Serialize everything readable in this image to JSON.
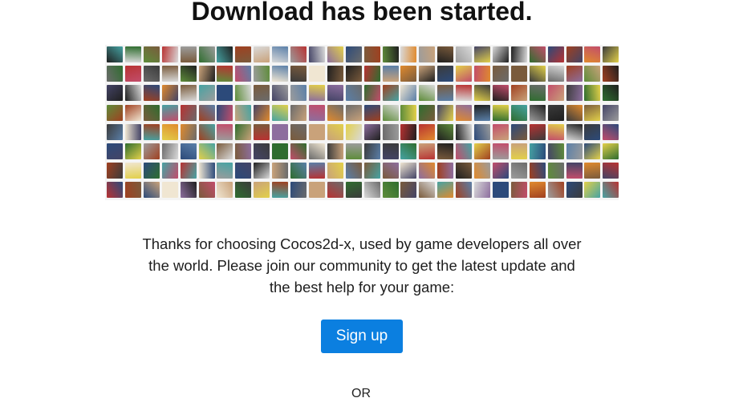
{
  "heading": "Download has been started.",
  "avatar_wall": {
    "description_icon": "developer-avatars-mosaic",
    "palette": [
      "#3b3b3b",
      "#7a5b3c",
      "#c9a27a",
      "#5a7fa8",
      "#2f6d2f",
      "#b83232",
      "#e2d04a",
      "#6b6b6b",
      "#d9d9d9",
      "#1f1f1f",
      "#8d6e9e",
      "#46a3a3",
      "#e08a2e",
      "#9c9c9c",
      "#c24d6b",
      "#2c4a7a",
      "#f0e6d2",
      "#5e8c3a",
      "#a04020",
      "#444466"
    ]
  },
  "blurb": "Thanks for choosing Cocos2d-x, used by game developers all over the world. Please join our community to get the latest update and the best help for your game:",
  "signup_label": "Sign up",
  "or_label": "OR",
  "colors": {
    "accent": "#0b7fe0",
    "text": "#1e1e1e",
    "background": "#ffffff"
  }
}
